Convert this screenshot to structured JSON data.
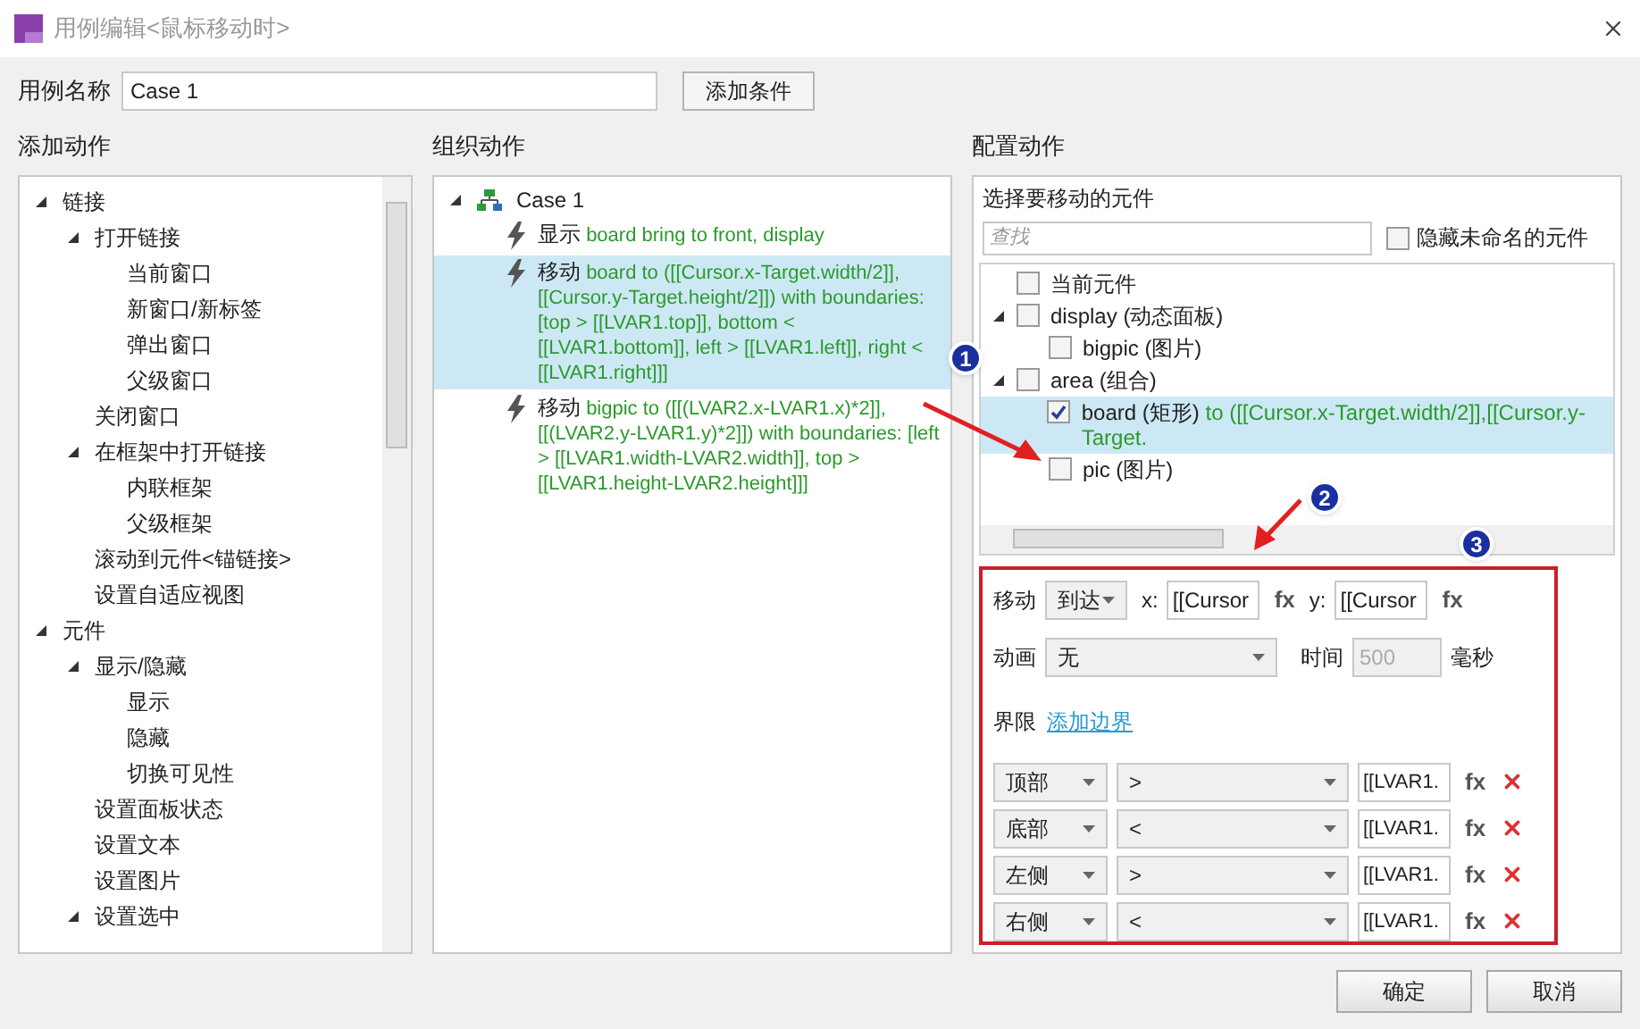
{
  "window": {
    "title": "用例编辑<鼠标移动时>"
  },
  "case_name": {
    "label": "用例名称",
    "value": "Case 1"
  },
  "add_condition_button": "添加条件",
  "add_actions": {
    "heading": "添加动作",
    "tree": [
      {
        "label": "链接",
        "expanded": true,
        "children": [
          {
            "label": "打开链接",
            "expanded": true,
            "children": [
              {
                "label": "当前窗口"
              },
              {
                "label": "新窗口/新标签"
              },
              {
                "label": "弹出窗口"
              },
              {
                "label": "父级窗口"
              }
            ]
          },
          {
            "label": "关闭窗口"
          },
          {
            "label": "在框架中打开链接",
            "expanded": true,
            "children": [
              {
                "label": "内联框架"
              },
              {
                "label": "父级框架"
              }
            ]
          },
          {
            "label": "滚动到元件<锚链接>"
          },
          {
            "label": "设置自适应视图"
          }
        ]
      },
      {
        "label": "元件",
        "expanded": true,
        "children": [
          {
            "label": "显示/隐藏",
            "expanded": true,
            "children": [
              {
                "label": "显示"
              },
              {
                "label": "隐藏"
              },
              {
                "label": "切换可见性"
              }
            ]
          },
          {
            "label": "设置面板状态"
          },
          {
            "label": "设置文本"
          },
          {
            "label": "设置图片"
          },
          {
            "label": "设置选中",
            "expanded": true
          }
        ]
      }
    ]
  },
  "organize_actions": {
    "heading": "组织动作",
    "case": {
      "label": "Case 1",
      "expanded": true
    },
    "actions": [
      {
        "verb": "显示",
        "detail": "board bring to front, display",
        "selected": false
      },
      {
        "verb": "移动",
        "detail": "board to ([[Cursor.x-Target.width/2]], [[Cursor.y-Target.height/2]]) with boundaries: [top > [[LVAR1.top]], bottom < [[LVAR1.bottom]], left > [[LVAR1.left]], right < [[LVAR1.right]]]",
        "selected": true
      },
      {
        "verb": "移动",
        "detail": "bigpic to ([[(LVAR2.x-LVAR1.x)*2]], [[(LVAR2.y-LVAR1.y)*2]]) with boundaries: [left > [[LVAR1.width-LVAR2.width]], top > [[LVAR1.height-LVAR2.height]]]",
        "selected": false
      }
    ]
  },
  "configure": {
    "heading": "配置动作",
    "widget_picker": {
      "heading": "选择要移动的元件",
      "search_placeholder": "查找",
      "hide_unnamed": {
        "label": "隐藏未命名的元件",
        "checked": false
      },
      "tree": [
        {
          "label": "当前元件",
          "checked": false,
          "selected": false
        },
        {
          "label": "display (动态面板)",
          "checked": false,
          "selected": false,
          "expanded": true,
          "children": [
            {
              "label": "bigpic (图片)",
              "checked": false,
              "selected": false
            }
          ]
        },
        {
          "label": "area (组合)",
          "checked": false,
          "selected": false,
          "expanded": true,
          "children": [
            {
              "label": "board (矩形)",
              "detail": "to ([[Cursor.x-Target.width/2]],[[Cursor.y-Target.",
              "checked": true,
              "selected": true
            },
            {
              "label": "pic (图片)",
              "checked": false,
              "selected": false
            }
          ]
        }
      ]
    },
    "move": {
      "label": "移动",
      "mode": "到达",
      "x_label": "x:",
      "x_value": "[[Cursor",
      "x_fx": "fx",
      "y_label": "y:",
      "y_value": "[[Cursor",
      "y_fx": "fx"
    },
    "animation": {
      "label": "动画",
      "value": "无",
      "time_label": "时间",
      "time_value": "500",
      "time_disabled": true,
      "unit": "毫秒"
    },
    "bounds": {
      "label": "界限",
      "add_link": "添加边界",
      "rows": [
        {
          "side": "顶部",
          "operator": ">",
          "value": "[[LVAR1.",
          "fx": "fx"
        },
        {
          "side": "底部",
          "operator": "<",
          "value": "[[LVAR1.",
          "fx": "fx"
        },
        {
          "side": "左侧",
          "operator": ">",
          "value": "[[LVAR1.",
          "fx": "fx"
        },
        {
          "side": "右侧",
          "operator": "<",
          "value": "[[LVAR1.",
          "fx": "fx"
        }
      ]
    }
  },
  "buttons": [
    {
      "label": "确定"
    },
    {
      "label": "取消"
    }
  ],
  "annotations": [
    {
      "number": "1"
    },
    {
      "number": "2"
    },
    {
      "number": "3"
    }
  ]
}
